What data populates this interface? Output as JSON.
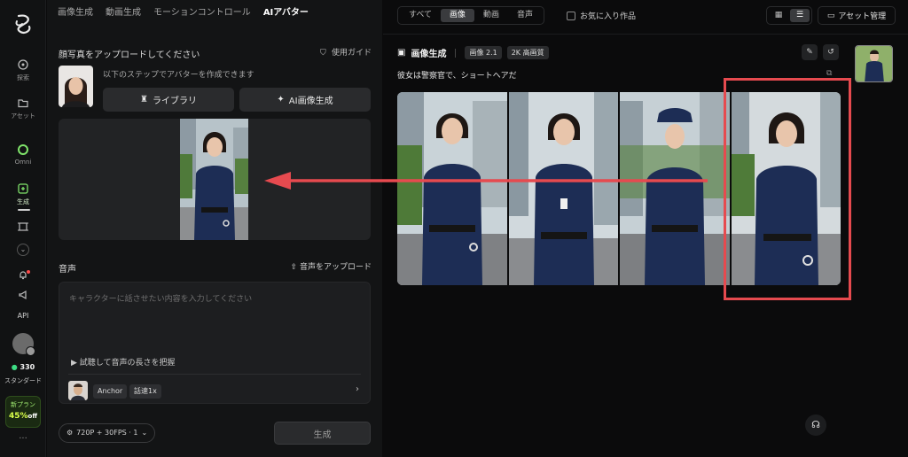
{
  "rail": {
    "items": [
      {
        "label": "探索",
        "icon": "explore-icon"
      },
      {
        "label": "アセット",
        "icon": "folder-icon"
      },
      {
        "label": "Omni",
        "icon": "omni-icon"
      },
      {
        "label": "生成",
        "icon": "generate-icon"
      },
      {
        "label": "",
        "icon": "frame-icon"
      },
      {
        "label": "",
        "icon": "bell-icon"
      },
      {
        "label": "",
        "icon": "megaphone-icon"
      },
      {
        "label": "API",
        "icon": ""
      }
    ],
    "credits": "330",
    "tier": "スタンダード",
    "promo_line1": "新プラン",
    "promo_pct": "45%",
    "promo_off": "off",
    "more": "···"
  },
  "panel": {
    "tabs": [
      "画像生成",
      "動画生成",
      "モーションコントロール",
      "AIアバター"
    ],
    "active_tab": 3,
    "photo_section_title": "顔写真をアップロードしてください",
    "guide_label": "使用ガイド",
    "step_text": "以下のステップでアバターを作成できます",
    "library_btn": "ライブラリ",
    "ai_gen_btn": "AI画像生成",
    "voice_title": "音声",
    "voice_upload": "音声をアップロード",
    "textarea_placeholder": "キャラクターに話させたい内容を入力してください",
    "preview_label": "試聴して音声の長さを把握",
    "voice_name": "Anchor",
    "speed": "話速1x",
    "resolution": "720P + 30FPS · 1",
    "generate_btn": "生成"
  },
  "right": {
    "filters": [
      "すべて",
      "画像",
      "動画",
      "音声"
    ],
    "active_filter": 1,
    "favorites": "お気に入り作品",
    "assets_btn": "アセット管理",
    "result_title": "画像生成",
    "model_tag": "画像 2.1",
    "quality_tag": "2K 高画質",
    "prompt": "彼女は警察官で、ショートヘアだ"
  },
  "colors": {
    "accent_red": "#e64a4f",
    "promo_green": "#d9ff4a",
    "credit_green": "#3ddc84"
  }
}
